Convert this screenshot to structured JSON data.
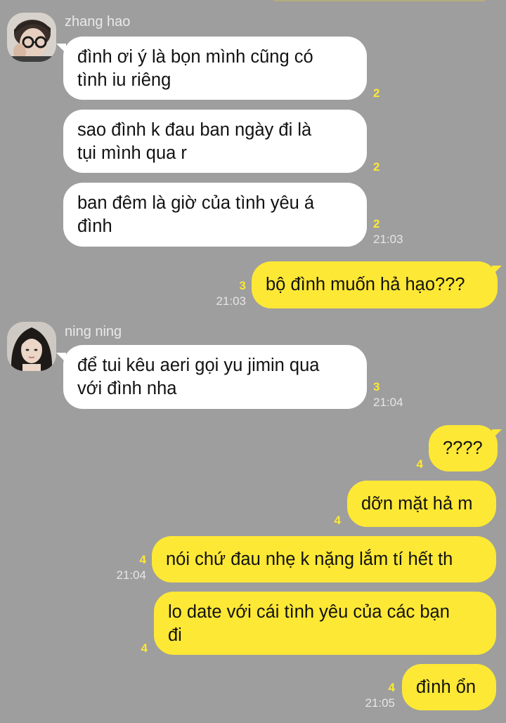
{
  "chat": {
    "messages": [
      {
        "sender": "zhang hao",
        "text1": "đình ơi ý là bọn mình cũng có",
        "text2": "tình iu riêng",
        "count": "2"
      },
      {
        "text1": "sao đình k đau ban ngày đi là",
        "text2": "tụi mình qua r",
        "count": "2"
      },
      {
        "text1": "ban đêm là giờ của tình yêu á",
        "text2": "đình",
        "count": "2",
        "time": "21:03"
      },
      {
        "text": "bộ đình muốn hả hạo???",
        "count": "3",
        "time": "21:03"
      },
      {
        "sender": "ning ning",
        "text1": "để tui kêu aeri gọi yu jimin qua",
        "text2": "với đình nha",
        "count": "3",
        "time": "21:04"
      },
      {
        "text": "????",
        "count": "4"
      },
      {
        "text": "dỡn mặt hả m",
        "count": "4"
      },
      {
        "text": "nói chứ đau nhẹ k nặng lắm tí hết th",
        "count": "4",
        "time": "21:04"
      },
      {
        "text1": "lo date với cái tình yêu của các bạn",
        "text2": "đi",
        "count": "4"
      },
      {
        "text": "đình ổn",
        "count": "4",
        "time": "21:05"
      }
    ]
  },
  "colors": {
    "background": "#9e9e9e",
    "outgoing_bubble": "#fde835",
    "incoming_bubble": "#ffffff",
    "unread_count": "#fde835"
  },
  "icons": [
    "avatar-zhang-hao",
    "avatar-ning-ning"
  ]
}
